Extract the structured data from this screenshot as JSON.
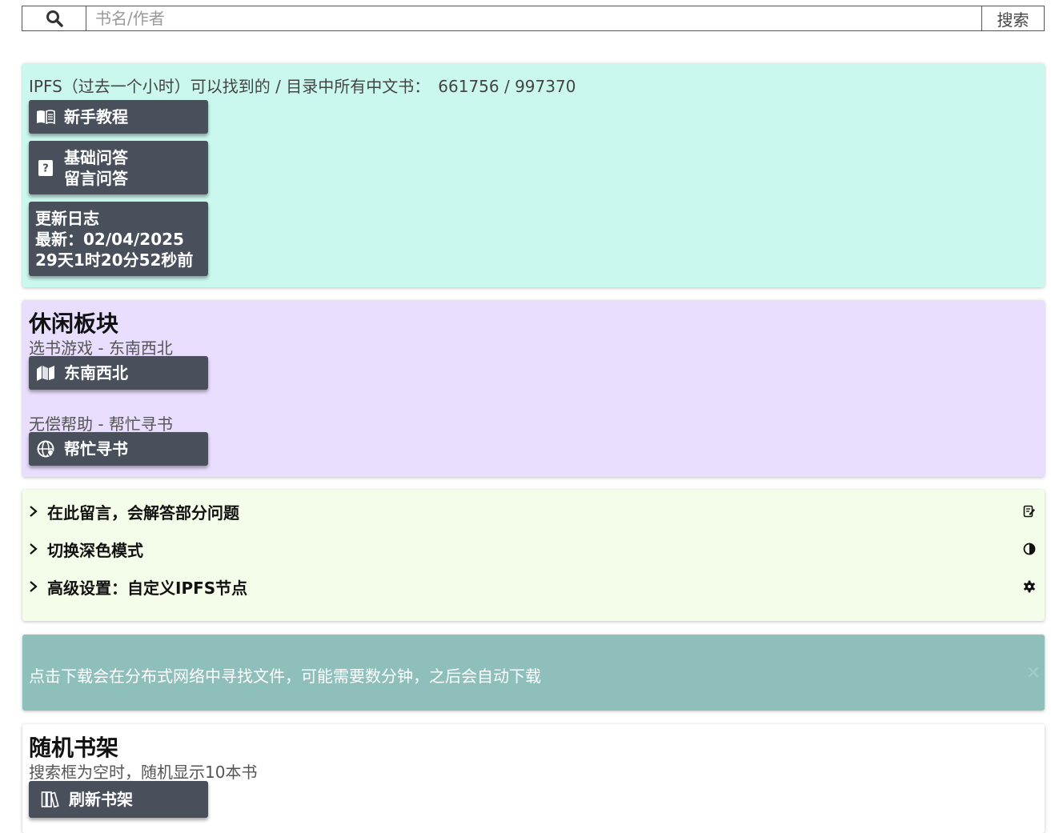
{
  "search": {
    "placeholder": "书名/作者",
    "button_label": "搜索",
    "icon": "search-icon"
  },
  "ipfs_panel": {
    "stat_label": "IPFS（过去一个小时）可以找到的 / 目录中所有中文书：",
    "stat_value": "661756 / 997370",
    "tutorial_button": {
      "label": "新手教程",
      "icon": "book-open-icon"
    },
    "faq_button": {
      "line1": "基础问答",
      "line2": "留言问答",
      "icon": "question-icon"
    },
    "changelog_button": {
      "line1": "更新日志",
      "line2": "最新：02/04/2025",
      "line3": "29天1时20分52秒前"
    }
  },
  "leisure_panel": {
    "title": "休闲板块",
    "game_caption": "选书游戏 - 东南西北",
    "game_button": {
      "label": "东南西北",
      "icon": "map-icon"
    },
    "help_caption": "无偿帮助 - 帮忙寻书",
    "help_button": {
      "label": "帮忙寻书",
      "icon": "globe-icon"
    }
  },
  "settings_panel": {
    "items": [
      {
        "label": "在此留言，会解答部分问题",
        "icon": "edit-note-icon"
      },
      {
        "label": "切换深色模式",
        "icon": "contrast-icon"
      },
      {
        "label": "高级设置：自定义IPFS节点",
        "icon": "gear-icon"
      }
    ]
  },
  "notice": {
    "text": "点击下载会在分布式网络中寻找文件，可能需要数分钟，之后会自动下载",
    "close": "×"
  },
  "shelf_panel": {
    "title": "随机书架",
    "subtitle": "搜索框为空时，随机显示10本书",
    "refresh_button": {
      "label": "刷新书架",
      "icon": "books-icon"
    }
  },
  "colors": {
    "ipfs_bg": "#cbf8ee",
    "leisure_bg": "#e9defd",
    "settings_bg": "#f3fde9",
    "notice_bg": "#8ebfba",
    "button_bg": "#4a505b"
  }
}
